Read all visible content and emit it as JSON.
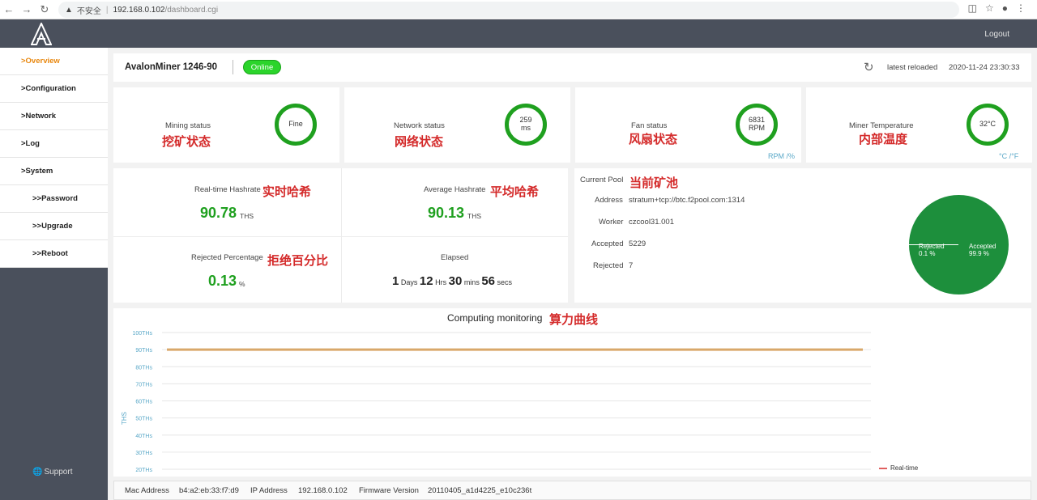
{
  "browser": {
    "security": "不安全",
    "host": "192.168.0.102",
    "path": "/dashboard.cgi"
  },
  "header": {
    "logout": "Logout"
  },
  "sidebar": {
    "items": [
      {
        "label": ">Overview",
        "active": true
      },
      {
        "label": ">Configuration"
      },
      {
        "label": ">Network"
      },
      {
        "label": ">Log"
      },
      {
        "label": ">System"
      },
      {
        "label": ">>Password"
      },
      {
        "label": ">>Upgrade"
      },
      {
        "label": ">>Reboot"
      }
    ],
    "support": "Support"
  },
  "title_bar": {
    "model": "AvalonMiner 1246-90",
    "status": "Online",
    "reload_label": "latest reloaded",
    "reload_time": "2020-11-24 23:30:33"
  },
  "status_cards": {
    "mining": {
      "label": "Mining status",
      "cn": "挖矿状态",
      "value": "Fine"
    },
    "network": {
      "label": "Network status",
      "cn": "网络状态",
      "value": "259",
      "unit": "ms"
    },
    "fan": {
      "label": "Fan status",
      "cn": "风扇状态",
      "value": "6831",
      "unit": "RPM",
      "note": "RPM /%"
    },
    "temp": {
      "label": "Miner Temperature",
      "cn": "内部温度",
      "value": "32°C",
      "note": "°C /°F"
    }
  },
  "hashrate": {
    "realtime": {
      "label": "Real-time Hashrate",
      "cn": "实时哈希",
      "value": "90.78",
      "unit": "THS"
    },
    "average": {
      "label": "Average Hashrate",
      "cn": "平均哈希",
      "value": "90.13",
      "unit": "THS"
    },
    "rejected": {
      "label": "Rejected Percentage",
      "cn": "拒绝百分比",
      "value": "0.13",
      "unit": "%"
    },
    "elapsed": {
      "label": "Elapsed",
      "days": "1",
      "days_unit": "Days",
      "hrs": "12",
      "hrs_unit": "Hrs",
      "mins": "30",
      "mins_unit": "mins",
      "secs": "56",
      "secs_unit": "secs"
    }
  },
  "pool": {
    "title": "Current Pool",
    "cn": "当前矿池",
    "address_label": "Address",
    "address": "stratum+tcp://btc.f2pool.com:1314",
    "worker_label": "Worker",
    "worker": "czcool31.001",
    "accepted_label": "Accepted",
    "accepted": "5229",
    "rejected_label": "Rejected",
    "rejected": "7",
    "pie": {
      "rejected_label": "Rejected",
      "rejected_pct": "0.1 %",
      "accepted_label": "Accepted",
      "accepted_pct": "99.9 %",
      "color": "#1d8f3c"
    }
  },
  "chart_data": {
    "type": "line",
    "title": "Computing monitoring",
    "title_cn": "算力曲线",
    "ylabel": "THS",
    "yticks": [
      "100THs",
      "90THs",
      "80THs",
      "70THs",
      "60THs",
      "50THs",
      "40THs",
      "30THs",
      "20THs"
    ],
    "ylim": [
      20,
      100
    ],
    "grid": true,
    "series": [
      {
        "name": "Real-time",
        "values": [
          90,
          90
        ],
        "color": "#d9a86a"
      }
    ],
    "legend_color": "#e06060",
    "legend_position": "bottom-right"
  },
  "footer": {
    "mac_label": "Mac Address",
    "mac": "b4:a2:eb:33:f7:d9",
    "ip_label": "IP Address",
    "ip": "192.168.0.102",
    "fw_label": "Firmware Version",
    "fw": "20110405_a1d4225_e10c236t"
  }
}
